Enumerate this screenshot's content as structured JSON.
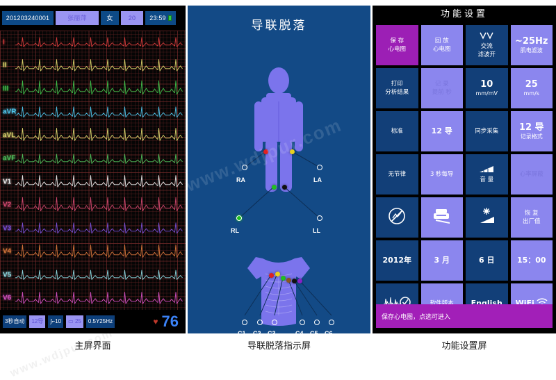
{
  "captions": {
    "main": "主屏界面",
    "leadoff": "导联脱落指示屏",
    "settings": "功能设置屏"
  },
  "main_screen": {
    "topbar": {
      "patient_id": "201203240001",
      "patient_name": "张丽萍",
      "sex": "女",
      "age": "20",
      "time": "23:59",
      "battery_icon": "battery-icon"
    },
    "leads": [
      {
        "label": "I",
        "color": "#d43b3b"
      },
      {
        "label": "II",
        "color": "#d8d06a"
      },
      {
        "label": "III",
        "color": "#3fbf4a"
      },
      {
        "label": "aVR",
        "color": "#4fc3e8"
      },
      {
        "label": "aVL",
        "color": "#d9d36d"
      },
      {
        "label": "aVF",
        "color": "#4fbf5a"
      },
      {
        "label": "V1",
        "color": "#e8e8e8"
      },
      {
        "label": "V2",
        "color": "#d0486f"
      },
      {
        "label": "V3",
        "color": "#7a4fd6"
      },
      {
        "label": "V4",
        "color": "#d2753a"
      },
      {
        "label": "V5",
        "color": "#8fd8e0"
      },
      {
        "label": "V6",
        "color": "#d04fc0"
      }
    ],
    "bottombar": {
      "mode": "3秒自动",
      "lead_count": "12导",
      "gain_icon": "gain-icon",
      "gain": "10",
      "speed_icon": "paper-icon",
      "speed": "25",
      "filter": "0.5Y25Hz",
      "heart_icon": "heart-icon",
      "heart_rate": "76"
    }
  },
  "leadoff_screen": {
    "title": "导联脱落",
    "limb_electrodes": [
      {
        "name": "RA",
        "color": "#e02020",
        "attached": true
      },
      {
        "name": "LA",
        "color": "#e8d020",
        "attached": true
      },
      {
        "name": "RL",
        "color": "#20c020",
        "attached": true
      },
      {
        "name": "LL",
        "color": "#101010",
        "attached": true
      }
    ],
    "chest_electrodes": [
      {
        "name": "C1",
        "color": "#e02020"
      },
      {
        "name": "C2",
        "color": "#e8d020"
      },
      {
        "name": "C3",
        "color": "#20c020"
      },
      {
        "name": "C4",
        "color": "#8a5520"
      },
      {
        "name": "C5",
        "color": "#101010"
      },
      {
        "name": "C6",
        "color": "#8820c8"
      }
    ]
  },
  "settings_screen": {
    "title": "功能设置",
    "status_text": "保存心电图，点选可进入",
    "keys": [
      {
        "style": "sel",
        "lines": [
          "保 存",
          "心电图"
        ]
      },
      {
        "style": "light",
        "lines": [
          "回 放",
          "心电图"
        ]
      },
      {
        "style": "dark",
        "icon": "ac-filter-icon",
        "lines": [
          "交流",
          "滤波开"
        ]
      },
      {
        "style": "light",
        "lines": [
          "~25Hz",
          "肌电滤波"
        ],
        "emph": 0
      },
      {
        "style": "dark",
        "lines": [
          "打印",
          "分析结果"
        ]
      },
      {
        "style": "ghost",
        "lines": [
          "记 录",
          "提前 秒"
        ]
      },
      {
        "style": "dark",
        "lines": [
          "10",
          "mm/mV"
        ],
        "emph": 0
      },
      {
        "style": "light",
        "lines": [
          "25",
          "mm/s"
        ],
        "emph": 0
      },
      {
        "style": "dark",
        "lines": [
          "标准"
        ]
      },
      {
        "style": "light",
        "lines": [
          "12 导"
        ],
        "emph": 0
      },
      {
        "style": "dark",
        "lines": [
          "同步采集"
        ]
      },
      {
        "style": "light",
        "lines": [
          "12 导",
          "记录格式"
        ],
        "emph": 0
      },
      {
        "style": "dark",
        "lines": [
          "无节律"
        ]
      },
      {
        "style": "light",
        "lines": [
          "3 秒每导"
        ]
      },
      {
        "style": "dark",
        "icon": "volume-icon",
        "lines": [
          "音 量"
        ]
      },
      {
        "style": "ghost",
        "lines": [
          "心率屏蔽"
        ]
      },
      {
        "style": "dark",
        "icon": "no-signal-icon",
        "lines": []
      },
      {
        "style": "light",
        "icon": "printer-icon",
        "lines": []
      },
      {
        "style": "dark",
        "icon": "brightness-icon",
        "lines": []
      },
      {
        "style": "light",
        "lines": [
          "恢 复",
          "出厂值"
        ]
      },
      {
        "style": "dark",
        "lines": [
          "2012年"
        ],
        "emph": 0
      },
      {
        "style": "light",
        "lines": [
          "3 月"
        ],
        "emph": 0
      },
      {
        "style": "dark",
        "lines": [
          "6 日"
        ],
        "emph": 0
      },
      {
        "style": "light",
        "lines": [
          "15：00"
        ],
        "emph": 0
      },
      {
        "style": "dark",
        "icon": "ecg-check-icon",
        "lines": []
      },
      {
        "style": "light",
        "lines": [
          "软件版本"
        ]
      },
      {
        "style": "dark",
        "lines": [
          "English"
        ],
        "emph": 0
      },
      {
        "style": "light",
        "icon": "wifi-icon",
        "lines": [
          "WiFi"
        ],
        "emph": 0
      }
    ]
  },
  "watermarks": [
    "www.wdjpur.com",
    "www.wdjpur.com"
  ]
}
